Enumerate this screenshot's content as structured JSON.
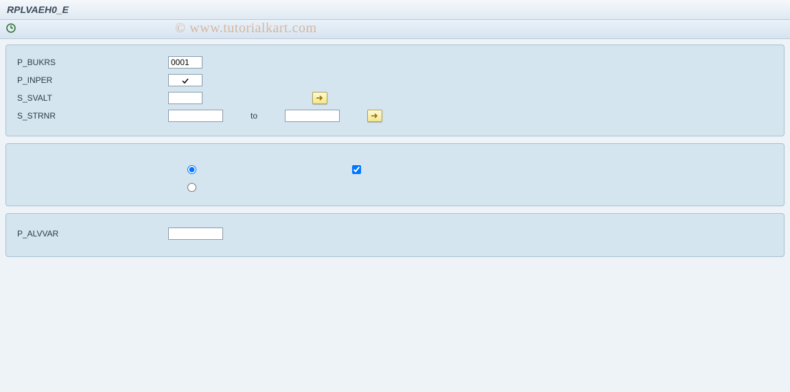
{
  "title": "RPLVAEH0_E",
  "watermark": "© www.tutorialkart.com",
  "toolbar": {
    "execute_icon": "execute"
  },
  "panel1": {
    "rows": [
      {
        "label": "P_BUKRS",
        "value": "0001"
      },
      {
        "label": "P_INPER",
        "checked": true
      },
      {
        "label": "S_SVALT",
        "value": ""
      },
      {
        "label": "S_STRNR",
        "value": "",
        "to_label": "to",
        "to_value": ""
      }
    ]
  },
  "panel2": {
    "radio1_selected": true,
    "radio2_selected": false,
    "check1_checked": true
  },
  "panel3": {
    "label": "P_ALVVAR",
    "value": ""
  }
}
